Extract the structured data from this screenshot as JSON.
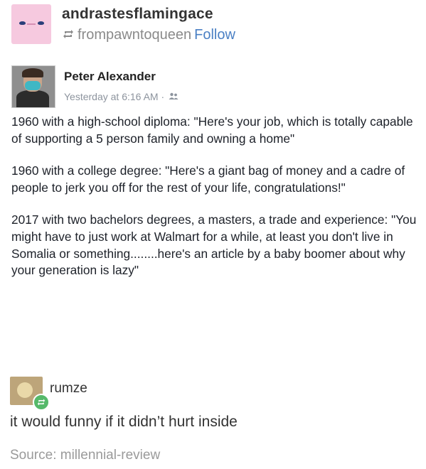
{
  "reblogger": {
    "username": "andrastesflamingace",
    "reblog_icon": "reblog-icon",
    "reblogged_from": "frompawntoqueen",
    "follow_label": "Follow"
  },
  "facebook_post": {
    "author": "Peter Alexander",
    "timestamp": "Yesterday at 6:16 AM",
    "separator": "·",
    "audience_icon": "friends-icon",
    "paragraphs": [
      "1960 with a high-school diploma: \"Here's your job, which is totally capable of supporting a 5 person family and owning a home\"",
      "1960 with a college degree: \"Here's a giant bag of money and a cadre of people to jerk you off for the rest of your life, congratulations!\"",
      "2017 with two bachelors degrees, a masters, a trade and experience: \"You might have to just work at Walmart for a while, at least you don't live in Somalia or something........here's an article by a baby boomer about why your generation is lazy\""
    ]
  },
  "reply": {
    "username": "rumze",
    "badge_icon": "reblog-badge-icon",
    "comment": "it would funny if it didn’t hurt inside"
  },
  "source_line": "Source: millennial-review",
  "colors": {
    "link_blue": "#4b80c4",
    "muted_gray": "#8a8a8a",
    "avatar_pink": "#f6c9df",
    "badge_green": "#56b96a"
  }
}
